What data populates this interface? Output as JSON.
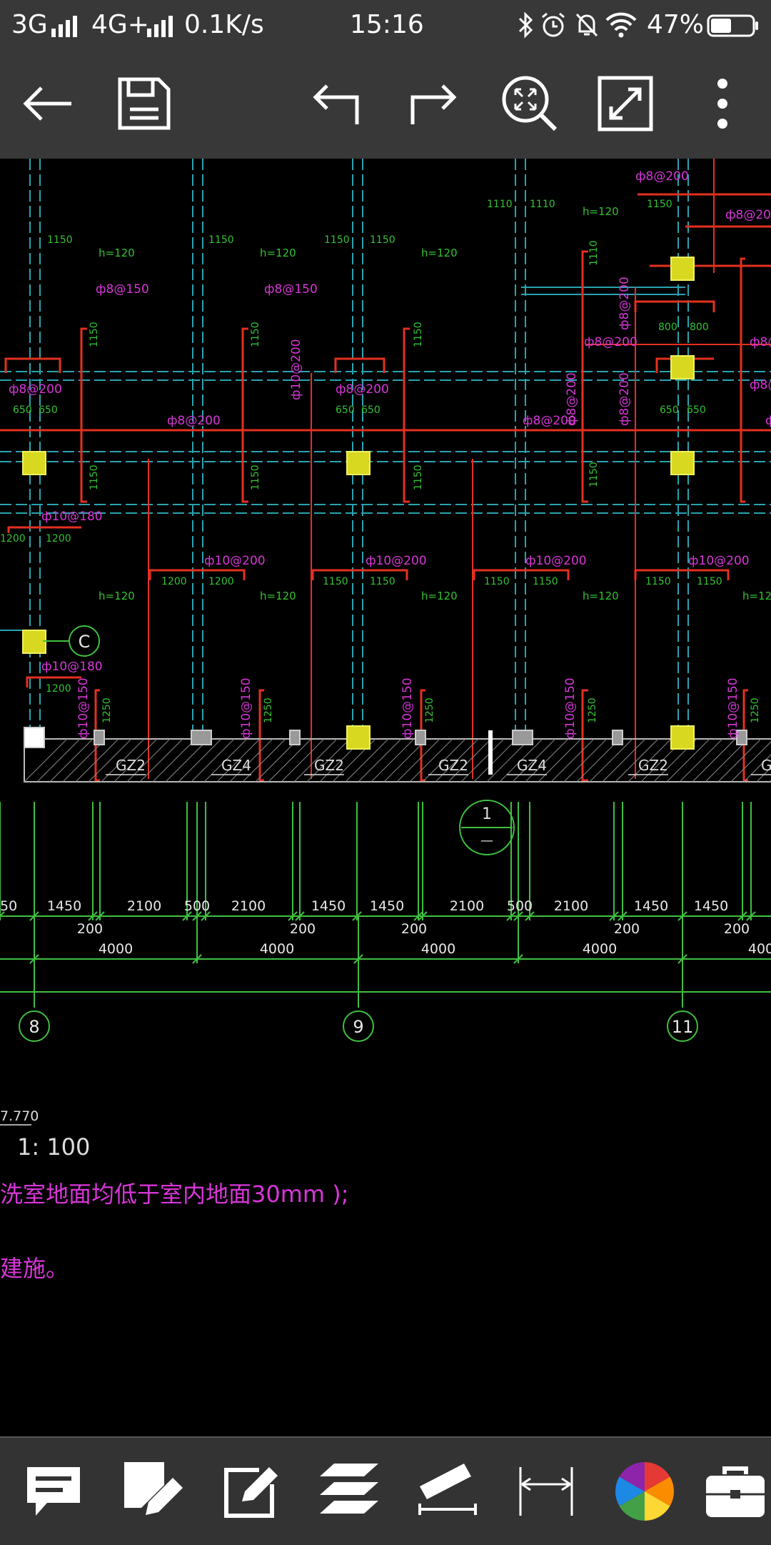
{
  "status_bar": {
    "network": "3G",
    "network2": "4G+",
    "speed": "0.1K/s",
    "time": "15:16",
    "battery": "47%"
  },
  "toolbar": {
    "icons": [
      "back-arrow-icon",
      "save-icon",
      "undo-icon",
      "redo-icon",
      "zoom-extents-icon",
      "fullscreen-icon",
      "more-vert-icon"
    ]
  },
  "drawing": {
    "rebar_labels": [
      "ф8@150",
      "ф8@150",
      "ф10@180",
      "ф8@200",
      "ф8@200",
      "ф8@200",
      "ф8@200",
      "ф8@200",
      "ф8@200",
      "ф10@200",
      "ф10@200",
      "ф10@200",
      "ф10@200",
      "ф10@180",
      "ф8@200",
      "ф8@200",
      "ф8@200",
      "ф10@200",
      "ф10@150",
      "ф10@150",
      "ф10@150",
      "ф10@150",
      "ф10@150",
      "ф8@20"
    ],
    "slab_label": "h=120",
    "column_labels": [
      "GZ2",
      "GZ4",
      "GZ2",
      "GZ2",
      "GZ4",
      "GZ2",
      "G"
    ],
    "dim_row1": [
      "50",
      "1450",
      "2100",
      "500",
      "2100",
      "1450",
      "1450",
      "2100",
      "500",
      "2100",
      "1450",
      "1450"
    ],
    "dim_row1_small": [
      "200",
      "200",
      "200",
      "200",
      "200"
    ],
    "dim_row2": [
      "4000",
      "4000",
      "4000",
      "4000",
      "400"
    ],
    "axis_labels": [
      "8",
      "9",
      "11",
      "C"
    ],
    "section_mark": {
      "num": "1",
      "sub": "—"
    },
    "elevation": "7.770",
    "scale": "1: 100",
    "note1": "洗室地面均低于室内地面30mm );",
    "note2": "建施。"
  },
  "bottom_bar": {
    "icons": [
      "comment-icon",
      "markup-pen-icon",
      "edit-icon",
      "layers-icon",
      "measure-ruler-icon",
      "dimension-icon",
      "color-wheel-icon",
      "toolbox-icon"
    ]
  }
}
